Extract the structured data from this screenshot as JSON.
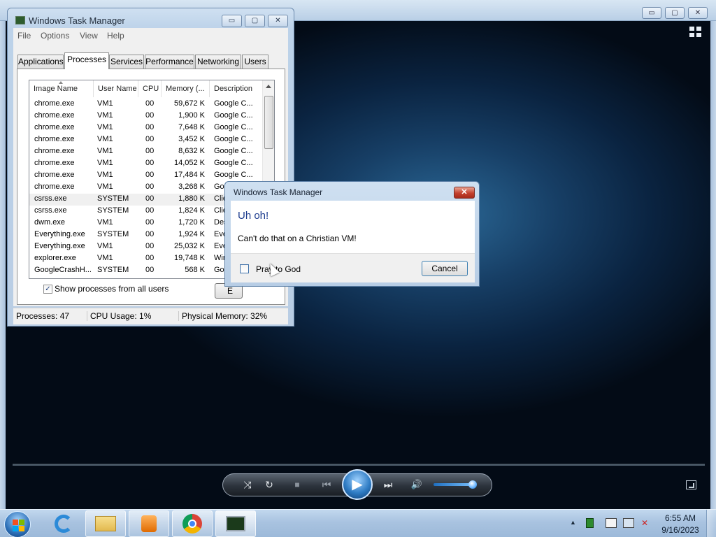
{
  "task_manager": {
    "title": "Windows Task Manager",
    "caption_buttons": {
      "minimize": "▭",
      "maximize": "▢",
      "close": "✕"
    },
    "menu": [
      "File",
      "Options",
      "View",
      "Help"
    ],
    "tabs": [
      "Applications",
      "Processes",
      "Services",
      "Performance",
      "Networking",
      "Users"
    ],
    "active_tab": "Processes",
    "columns": [
      "Image Name",
      "User Name",
      "CPU",
      "Memory (...",
      "Description"
    ],
    "processes": [
      {
        "image": "chrome.exe",
        "user": "VM1",
        "cpu": "00",
        "memory": "59,672 K",
        "description": "Google C..."
      },
      {
        "image": "chrome.exe",
        "user": "VM1",
        "cpu": "00",
        "memory": "1,900 K",
        "description": "Google C..."
      },
      {
        "image": "chrome.exe",
        "user": "VM1",
        "cpu": "00",
        "memory": "7,648 K",
        "description": "Google C..."
      },
      {
        "image": "chrome.exe",
        "user": "VM1",
        "cpu": "00",
        "memory": "3,452 K",
        "description": "Google C..."
      },
      {
        "image": "chrome.exe",
        "user": "VM1",
        "cpu": "00",
        "memory": "8,632 K",
        "description": "Google C..."
      },
      {
        "image": "chrome.exe",
        "user": "VM1",
        "cpu": "00",
        "memory": "14,052 K",
        "description": "Google C..."
      },
      {
        "image": "chrome.exe",
        "user": "VM1",
        "cpu": "00",
        "memory": "17,484 K",
        "description": "Google C..."
      },
      {
        "image": "chrome.exe",
        "user": "VM1",
        "cpu": "00",
        "memory": "3,268 K",
        "description": "Google C..."
      },
      {
        "image": "csrss.exe",
        "user": "SYSTEM",
        "cpu": "00",
        "memory": "1,880 K",
        "description": "Clie"
      },
      {
        "image": "csrss.exe",
        "user": "SYSTEM",
        "cpu": "00",
        "memory": "1,824 K",
        "description": "Clie"
      },
      {
        "image": "dwm.exe",
        "user": "VM1",
        "cpu": "00",
        "memory": "1,720 K",
        "description": "Des"
      },
      {
        "image": "Everything.exe",
        "user": "SYSTEM",
        "cpu": "00",
        "memory": "1,924 K",
        "description": "Eve"
      },
      {
        "image": "Everything.exe",
        "user": "VM1",
        "cpu": "00",
        "memory": "25,032 K",
        "description": "Eve"
      },
      {
        "image": "explorer.exe",
        "user": "VM1",
        "cpu": "00",
        "memory": "19,748 K",
        "description": "Win"
      },
      {
        "image": "GoogleCrashH...",
        "user": "SYSTEM",
        "cpu": "00",
        "memory": "568 K",
        "description": "Goo"
      }
    ],
    "show_all_users_label": "Show processes from all users",
    "show_all_users_checked": true,
    "end_process_label": "E",
    "status": {
      "processes": "Processes: 47",
      "cpu": "CPU Usage: 1%",
      "memory": "Physical Memory: 32%"
    }
  },
  "dialog": {
    "title": "Windows Task Manager",
    "heading": "Uh oh!",
    "message": "Can't do that on a Christian VM!",
    "checkbox_label": "Pray to God",
    "checkbox_checked": false,
    "cancel_label": "Cancel",
    "close_glyph": "✕"
  },
  "media_player": {
    "caption_buttons": {
      "minimize": "▭",
      "maximize": "▢",
      "close": "✕"
    },
    "controls": {
      "shuffle": "⤨",
      "repeat": "↻",
      "stop": "■",
      "previous": "⏮",
      "play": "▶",
      "next": "⏭",
      "volume": "🔊"
    },
    "volume_level": 0.85
  },
  "taskbar": {
    "clock_time": "6:55 AM",
    "clock_date": "9/16/2023",
    "pinned": [
      "internet-explorer",
      "windows-explorer",
      "windows-media-player",
      "google-chrome",
      "task-manager"
    ],
    "tray_expand": "▲"
  }
}
